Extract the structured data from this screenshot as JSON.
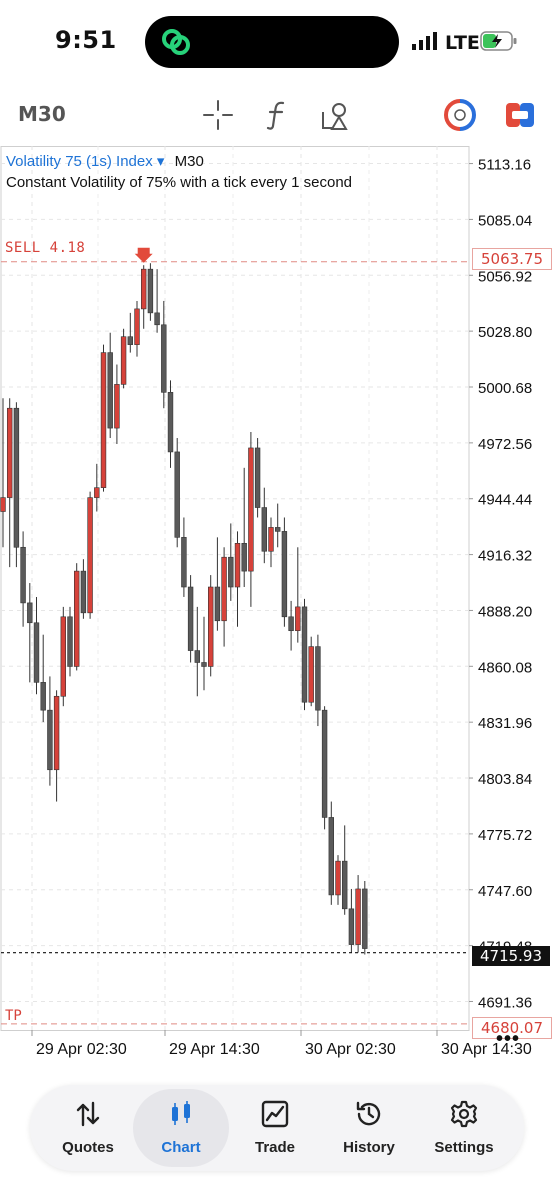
{
  "status_bar": {
    "time": "9:51",
    "network": "LTE"
  },
  "toolbar": {
    "timeframe": "M30",
    "icons": [
      "crosshair-icon",
      "indicator-f-icon",
      "objects-icon",
      "trade-circle-icon",
      "sell-buy-icon"
    ]
  },
  "chart": {
    "symbol": "Volatility 75 (1s) Index",
    "dropdown_glyph": "▾",
    "timeframe": "M30",
    "description": "Constant Volatility of 75% with a tick every 1 second",
    "price_labels": [
      "5113.16",
      "5085.04",
      "5056.92",
      "5028.80",
      "5000.68",
      "4972.56",
      "4944.44",
      "4916.32",
      "4888.20",
      "4860.08",
      "4831.96",
      "4803.84",
      "4775.72",
      "4747.60",
      "4719.48",
      "4691.36"
    ],
    "time_labels": [
      "29 Apr 02:30",
      "29 Apr 14:30",
      "30 Apr 02:30",
      "30 Apr 14:30"
    ],
    "sell_label": "SELL 4.18",
    "sell_price": "5063.75",
    "current_price": "4715.93",
    "tp_label": "TP",
    "tp_price": "4680.07",
    "more_glyph": "•••",
    "colors": {
      "bull": "#d6423a",
      "bear": "#5a5a5a",
      "symbol": "#1e73d6",
      "level": "#e08a84"
    }
  },
  "chart_data": {
    "type": "candlestick",
    "y_axis": {
      "min": 4677,
      "max": 5122
    },
    "price_levels": {
      "sell": 5063.75,
      "current": 4715.93,
      "tp": 4680.07
    },
    "candles": [
      {
        "o": 4938,
        "h": 4995,
        "l": 4920,
        "c": 4945
      },
      {
        "o": 4945,
        "h": 4995,
        "l": 4910,
        "c": 4990
      },
      {
        "o": 4990,
        "h": 4993,
        "l": 4910,
        "c": 4920
      },
      {
        "o": 4920,
        "h": 4928,
        "l": 4880,
        "c": 4892
      },
      {
        "o": 4892,
        "h": 4902,
        "l": 4852,
        "c": 4882
      },
      {
        "o": 4882,
        "h": 4895,
        "l": 4846,
        "c": 4852
      },
      {
        "o": 4852,
        "h": 4876,
        "l": 4832,
        "c": 4838
      },
      {
        "o": 4838,
        "h": 4855,
        "l": 4800,
        "c": 4808
      },
      {
        "o": 4808,
        "h": 4848,
        "l": 4792,
        "c": 4845
      },
      {
        "o": 4845,
        "h": 4890,
        "l": 4840,
        "c": 4885
      },
      {
        "o": 4885,
        "h": 4890,
        "l": 4855,
        "c": 4860
      },
      {
        "o": 4860,
        "h": 4912,
        "l": 4858,
        "c": 4908
      },
      {
        "o": 4908,
        "h": 4914,
        "l": 4884,
        "c": 4887
      },
      {
        "o": 4887,
        "h": 4948,
        "l": 4884,
        "c": 4945
      },
      {
        "o": 4945,
        "h": 4962,
        "l": 4938,
        "c": 4950
      },
      {
        "o": 4950,
        "h": 5022,
        "l": 4948,
        "c": 5018
      },
      {
        "o": 5018,
        "h": 5028,
        "l": 4975,
        "c": 4980
      },
      {
        "o": 4980,
        "h": 5012,
        "l": 4972,
        "c": 5002
      },
      {
        "o": 5002,
        "h": 5030,
        "l": 5000,
        "c": 5026
      },
      {
        "o": 5026,
        "h": 5038,
        "l": 5018,
        "c": 5022
      },
      {
        "o": 5022,
        "h": 5044,
        "l": 5016,
        "c": 5040
      },
      {
        "o": 5040,
        "h": 5062,
        "l": 5030,
        "c": 5060
      },
      {
        "o": 5060,
        "h": 5063,
        "l": 5034,
        "c": 5038
      },
      {
        "o": 5038,
        "h": 5060,
        "l": 5028,
        "c": 5032
      },
      {
        "o": 5032,
        "h": 5044,
        "l": 4990,
        "c": 4998
      },
      {
        "o": 4998,
        "h": 5004,
        "l": 4960,
        "c": 4968
      },
      {
        "o": 4968,
        "h": 4975,
        "l": 4920,
        "c": 4925
      },
      {
        "o": 4925,
        "h": 4935,
        "l": 4895,
        "c": 4900
      },
      {
        "o": 4900,
        "h": 4906,
        "l": 4862,
        "c": 4868
      },
      {
        "o": 4868,
        "h": 4890,
        "l": 4845,
        "c": 4862
      },
      {
        "o": 4862,
        "h": 4885,
        "l": 4848,
        "c": 4860
      },
      {
        "o": 4860,
        "h": 4906,
        "l": 4855,
        "c": 4900
      },
      {
        "o": 4900,
        "h": 4925,
        "l": 4878,
        "c": 4883
      },
      {
        "o": 4883,
        "h": 4920,
        "l": 4870,
        "c": 4915
      },
      {
        "o": 4915,
        "h": 4932,
        "l": 4893,
        "c": 4900
      },
      {
        "o": 4900,
        "h": 4928,
        "l": 4880,
        "c": 4922
      },
      {
        "o": 4922,
        "h": 4960,
        "l": 4900,
        "c": 4908
      },
      {
        "o": 4908,
        "h": 4978,
        "l": 4890,
        "c": 4970
      },
      {
        "o": 4970,
        "h": 4975,
        "l": 4935,
        "c": 4940
      },
      {
        "o": 4940,
        "h": 4950,
        "l": 4912,
        "c": 4918
      },
      {
        "o": 4918,
        "h": 4935,
        "l": 4910,
        "c": 4930
      },
      {
        "o": 4930,
        "h": 4942,
        "l": 4920,
        "c": 4928
      },
      {
        "o": 4928,
        "h": 4935,
        "l": 4880,
        "c": 4885
      },
      {
        "o": 4885,
        "h": 4893,
        "l": 4868,
        "c": 4878
      },
      {
        "o": 4878,
        "h": 4920,
        "l": 4872,
        "c": 4890
      },
      {
        "o": 4890,
        "h": 4894,
        "l": 4838,
        "c": 4842
      },
      {
        "o": 4842,
        "h": 4875,
        "l": 4840,
        "c": 4870
      },
      {
        "o": 4870,
        "h": 4876,
        "l": 4830,
        "c": 4838
      },
      {
        "o": 4838,
        "h": 4840,
        "l": 4778,
        "c": 4784
      },
      {
        "o": 4784,
        "h": 4792,
        "l": 4740,
        "c": 4745
      },
      {
        "o": 4745,
        "h": 4765,
        "l": 4740,
        "c": 4762
      },
      {
        "o": 4762,
        "h": 4780,
        "l": 4735,
        "c": 4738
      },
      {
        "o": 4738,
        "h": 4748,
        "l": 4716,
        "c": 4720
      },
      {
        "o": 4720,
        "h": 4755,
        "l": 4716,
        "c": 4748
      },
      {
        "o": 4748,
        "h": 4752,
        "l": 4715,
        "c": 4718
      }
    ]
  },
  "tabs": [
    {
      "label": "Quotes",
      "icon": "quotes-icon",
      "active": false
    },
    {
      "label": "Chart",
      "icon": "chart-candles-icon",
      "active": true
    },
    {
      "label": "Trade",
      "icon": "trade-icon",
      "active": false
    },
    {
      "label": "History",
      "icon": "history-icon",
      "active": false
    },
    {
      "label": "Settings",
      "icon": "settings-icon",
      "active": false
    }
  ]
}
